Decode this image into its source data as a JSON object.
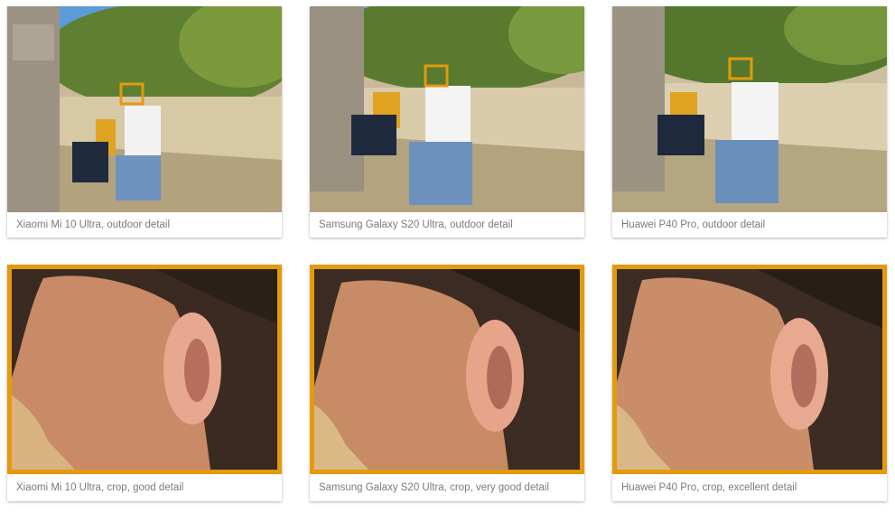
{
  "accent_color": "#e39a0d",
  "outdoor": [
    {
      "caption": "Xiaomi Mi 10 Ultra, outdoor detail",
      "icon": "outdoor-photo"
    },
    {
      "caption": "Samsung Galaxy S20 Ultra, outdoor detail",
      "icon": "outdoor-photo"
    },
    {
      "caption": "Huawei P40 Pro, outdoor detail",
      "icon": "outdoor-photo"
    }
  ],
  "crops": [
    {
      "caption": "Xiaomi Mi 10 Ultra, crop, good detail",
      "icon": "ear-crop-photo"
    },
    {
      "caption": "Samsung Galaxy S20 Ultra, crop, very good detail",
      "icon": "ear-crop-photo"
    },
    {
      "caption": "Huawei P40 Pro, crop, excellent detail",
      "icon": "ear-crop-photo"
    }
  ]
}
